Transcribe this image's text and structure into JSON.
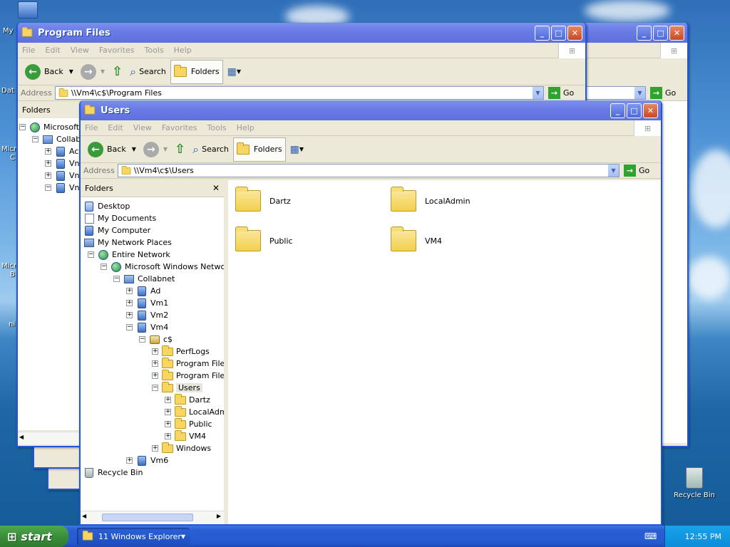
{
  "desktop": {
    "icons_left": [
      "My",
      "Dat",
      "Micr",
      "C",
      "Micr",
      "B",
      "ni"
    ],
    "recycle_bin": "Recycle Bin"
  },
  "back_window": {
    "title": "Program Files",
    "menu": [
      "File",
      "Edit",
      "View",
      "Favorites",
      "Tools",
      "Help"
    ],
    "back": "Back",
    "search": "Search",
    "folders": "Folders",
    "address_label": "Address",
    "address": "\\\\Vm4\\c$\\Program Files",
    "go": "Go",
    "panel_title": "Folders",
    "tree": [
      "Microsoft W",
      "Collab",
      "Ac",
      "Vn",
      "Vn",
      "Vn"
    ]
  },
  "front_window": {
    "title": "Users",
    "menu": [
      "File",
      "Edit",
      "View",
      "Favorites",
      "Tools",
      "Help"
    ],
    "back": "Back",
    "search": "Search",
    "folders": "Folders",
    "address_label": "Address",
    "address": "\\\\Vm4\\c$\\Users",
    "go": "Go",
    "panel_title": "Folders",
    "tree": [
      {
        "label": "Desktop",
        "level": 0,
        "icon": "desktop",
        "pm": ""
      },
      {
        "label": "My Documents",
        "level": 0,
        "icon": "doc",
        "pm": ""
      },
      {
        "label": "My Computer",
        "level": 0,
        "icon": "comp",
        "pm": ""
      },
      {
        "label": "My Network Places",
        "level": 0,
        "icon": "net",
        "pm": ""
      },
      {
        "label": "Entire Network",
        "level": 1,
        "icon": "globe",
        "pm": "−"
      },
      {
        "label": "Microsoft Windows Network",
        "level": 2,
        "icon": "globe",
        "pm": "−"
      },
      {
        "label": "Collabnet",
        "level": 3,
        "icon": "net",
        "pm": "−"
      },
      {
        "label": "Ad",
        "level": 4,
        "icon": "comp",
        "pm": "+"
      },
      {
        "label": "Vm1",
        "level": 4,
        "icon": "comp",
        "pm": "+"
      },
      {
        "label": "Vm2",
        "level": 4,
        "icon": "comp",
        "pm": "+"
      },
      {
        "label": "Vm4",
        "level": 4,
        "icon": "comp",
        "pm": "−"
      },
      {
        "label": "c$",
        "level": 5,
        "icon": "drive",
        "pm": "−"
      },
      {
        "label": "PerfLogs",
        "level": 6,
        "icon": "folder",
        "pm": "+"
      },
      {
        "label": "Program Files",
        "level": 6,
        "icon": "folder",
        "pm": "+"
      },
      {
        "label": "Program Files",
        "level": 6,
        "icon": "folder",
        "pm": "+"
      },
      {
        "label": "Users",
        "level": 6,
        "icon": "folder",
        "pm": "−"
      },
      {
        "label": "Dartz",
        "level": 7,
        "icon": "folder",
        "pm": "+"
      },
      {
        "label": "LocalAdm",
        "level": 7,
        "icon": "folder",
        "pm": "+"
      },
      {
        "label": "Public",
        "level": 7,
        "icon": "folder",
        "pm": "+"
      },
      {
        "label": "VM4",
        "level": 7,
        "icon": "folder",
        "pm": "+"
      },
      {
        "label": "Windows",
        "level": 6,
        "icon": "folder",
        "pm": "+"
      },
      {
        "label": "Vm6",
        "level": 4,
        "icon": "comp",
        "pm": "+"
      },
      {
        "label": "Recycle Bin",
        "level": 0,
        "icon": "rb",
        "pm": ""
      }
    ],
    "files": [
      "Dartz",
      "LocalAdmin",
      "Public",
      "VM4"
    ]
  },
  "taskbar": {
    "start": "start",
    "group": "11 Windows Explorer",
    "clock": "12:55 PM"
  }
}
